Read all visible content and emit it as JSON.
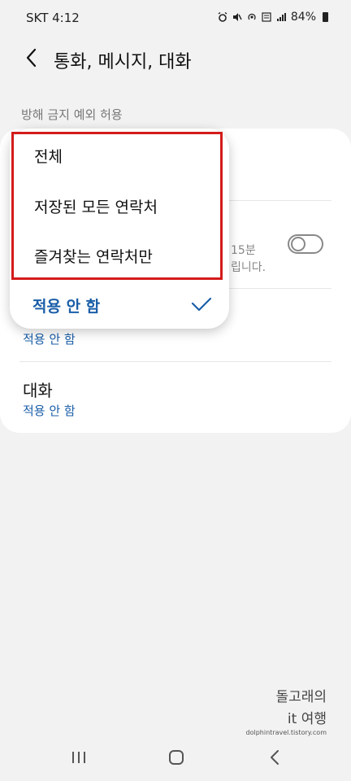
{
  "status_bar": {
    "carrier_time": "SKT  4:12",
    "battery_percent": "84%",
    "icons": [
      "alarm-icon",
      "mute-icon",
      "hotspot-icon",
      "vowifi-icon",
      "signal-icon",
      "battery-icon"
    ]
  },
  "header": {
    "title": "통화, 메시지, 대화",
    "back_icon": "chevron-left-icon"
  },
  "section_label": "방해 금지 예외 허용",
  "card": {
    "partial_description_line1": "15분",
    "partial_description_line2": "립니다.",
    "toggle_on": false,
    "row_hidden_value": "적용 안 함",
    "conversation_title": "대화",
    "conversation_value": "적용 안 함"
  },
  "dropdown": {
    "options": [
      "전체",
      "저장된 모든 연락처",
      "즐겨찾는 연락처만"
    ],
    "selected": "적용 안 함",
    "selected_icon": "checkmark-icon"
  },
  "watermark": {
    "line1": "돌고래의",
    "line2": "it 여행",
    "line3": "dolphintravel.tistory.com"
  },
  "navigation_bar": {
    "icons": [
      "recents-icon",
      "home-icon",
      "back-icon"
    ]
  },
  "colors": {
    "accent": "#1a5ea8",
    "highlight_border": "#d41b1b",
    "background": "#f2f2f2"
  }
}
